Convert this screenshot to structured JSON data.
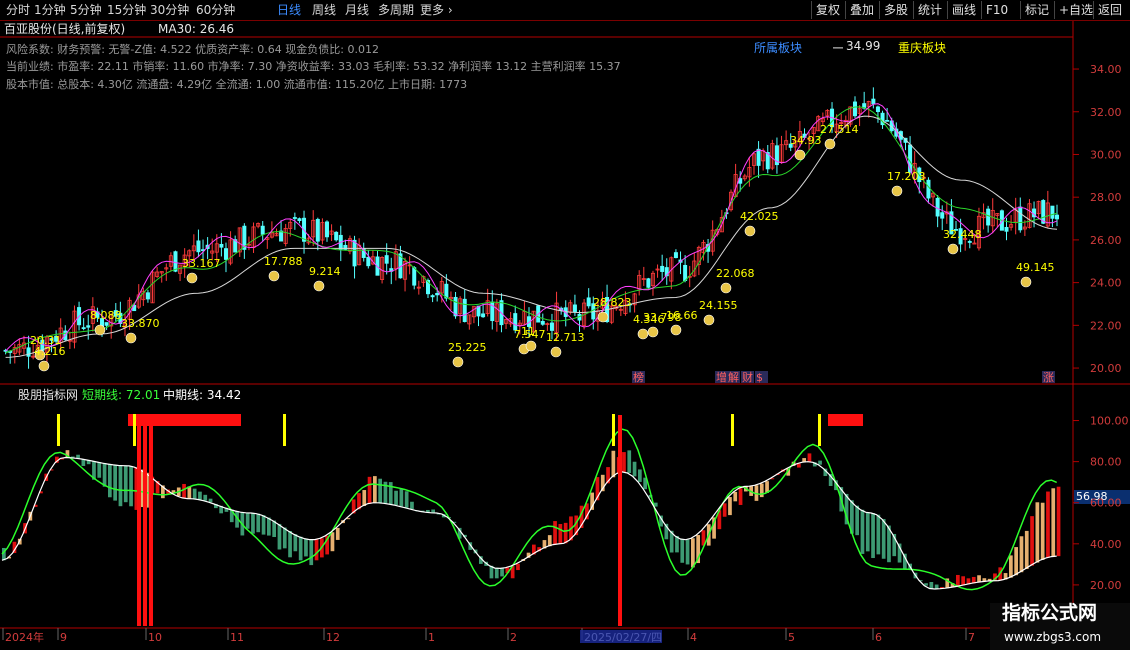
{
  "toolbar": {
    "periods": [
      "分时",
      "1分钟",
      "5分钟",
      "15分钟",
      "30分钟",
      "60分钟",
      "日线",
      "周线",
      "月线",
      "多周期",
      "更多 ›"
    ],
    "active_period": "日线",
    "right_buttons": [
      "复权",
      "叠加",
      "多股",
      "统计",
      "画线",
      "F10",
      "标记",
      "+自选",
      "返回"
    ]
  },
  "header": {
    "title": "百亚股份(日线,前复权)",
    "ma_label": "MA30: 26.46"
  },
  "info": {
    "line1": "风险系数: 财务预警: 无警-Z值: 4.522 优质资产率: 0.64 现金负债比: 0.012",
    "line2": "当前业绩: 市盈率: 22.11 市销率: 11.60 市净率: 7.30 净资收益率: 33.03 毛利率: 53.32 净利润率 13.12 主营利润率 15.37",
    "line3": "股本市值: 总股本: 4.30亿 流通盘: 4.29亿 全流通: 1.00 流通市值: 115.20亿 上市日期: 1773"
  },
  "sector_tags": {
    "sector1": "所属板块",
    "sector2": "重庆板块",
    "peak_value": "34.99"
  },
  "price_axis": {
    "ticks": [
      "34.00",
      "32.00",
      "30.00",
      "28.00",
      "26.00",
      "24.00",
      "22.00",
      "20.00"
    ]
  },
  "money_bags": [
    "20.31",
    "4.216",
    "8.088",
    "33.870",
    "33.167",
    "17.788",
    "9.214",
    "25.225",
    "7.547",
    "11",
    "12.713",
    "28.823",
    "4.346",
    "33.798",
    "16.66",
    "24.155",
    "22.068",
    "42.025",
    "34.93",
    "27.514",
    "17.203",
    "32.448",
    "49.145"
  ],
  "event_markers": [
    "榜",
    "增",
    "解",
    "财",
    "$",
    "涨"
  ],
  "indicator": {
    "name": "股朋指标网",
    "short_label": "短期线: 72.01",
    "mid_label": "中期线: 34.42",
    "ticks": [
      "100.00",
      "80.00",
      "60.00",
      "40.00",
      "20.00"
    ],
    "current_value": "56.98"
  },
  "time_axis": {
    "labels": [
      "2024年",
      "9",
      "10",
      "11",
      "12",
      "1",
      "2",
      "2025/02/27/四",
      "4",
      "5",
      "6",
      "7"
    ]
  },
  "watermark": {
    "title": "指标公式网",
    "url": "www.zbgs3.com"
  },
  "colors": {
    "up": "#ff3b3b",
    "down": "#54ffff",
    "axis": "#b40000",
    "active": "#3c8cff"
  },
  "chart_data": [
    {
      "type": "candlestick",
      "title": "百亚股份(日线,前复权)",
      "ylim": [
        19.3,
        35.5
      ],
      "yticks": [
        20,
        22,
        24,
        26,
        28,
        30,
        32,
        34
      ],
      "x": [
        "2024-08",
        "2024-09",
        "2024-10",
        "2024-11",
        "2024-12",
        "2025-01",
        "2025-02",
        "2025-03",
        "2025-04",
        "2025-05",
        "2025-06",
        "2025-07"
      ],
      "close": [
        20.8,
        22.3,
        25.5,
        26.5,
        25.0,
        22.5,
        22.4,
        24.5,
        30.0,
        32.2,
        26.5,
        27.3
      ],
      "series": [
        {
          "name": "MA30",
          "values": [
            20.5,
            21.6,
            23.5,
            25.6,
            25.6,
            23.5,
            22.6,
            23.3,
            27.5,
            31.8,
            28.8,
            26.5
          ]
        }
      ],
      "annotations": [
        "34.99"
      ]
    },
    {
      "type": "line",
      "ylim": [
        0,
        110
      ],
      "yticks": [
        20,
        40,
        60,
        80,
        100
      ],
      "series": [
        {
          "name": "短期线",
          "values": [
            35,
            88,
            60,
            72,
            45,
            30,
            75,
            55,
            22,
            50,
            90,
            30,
            65,
            85,
            35,
            20,
            25,
            72
          ]
        },
        {
          "name": "中期线",
          "values": [
            32,
            82,
            78,
            62,
            55,
            42,
            60,
            55,
            28,
            40,
            75,
            42,
            68,
            80,
            55,
            18,
            22,
            34
          ]
        }
      ]
    }
  ]
}
